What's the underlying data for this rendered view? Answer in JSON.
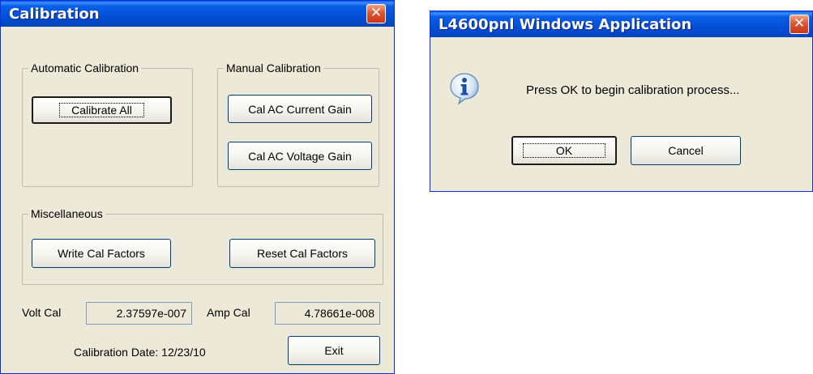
{
  "calibration_window": {
    "title": "Calibration",
    "close_symbol": "✕",
    "auto_group": {
      "label": "Automatic Calibration",
      "calibrate_all_label": "Calibrate All"
    },
    "manual_group": {
      "label": "Manual Calibration",
      "cal_ac_current_label": "Cal AC Current Gain",
      "cal_ac_voltage_label": "Cal AC Voltage Gain"
    },
    "misc_group": {
      "label": "Miscellaneous",
      "write_label": "Write Cal Factors",
      "reset_label": "Reset Cal Factors"
    },
    "volt_cal_label": "Volt Cal",
    "volt_cal_value": "2.37597e-007",
    "amp_cal_label": "Amp Cal",
    "amp_cal_value": "4.78661e-008",
    "cal_date_text": "Calibration Date: 12/23/10",
    "exit_label": "Exit"
  },
  "message_box": {
    "title": "L4600pnl Windows Application",
    "close_symbol": "✕",
    "message": "Press OK to begin calibration process...",
    "icon": "info-icon",
    "ok_label": "OK",
    "cancel_label": "Cancel"
  },
  "colors": {
    "titlebar": "#0a5fe8",
    "window_face": "#ece9d8",
    "close_button": "#e0542e"
  }
}
